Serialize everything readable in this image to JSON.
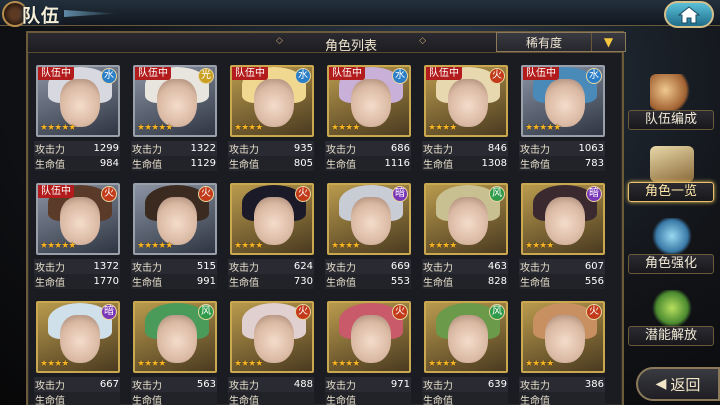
{
  "header": {
    "title": "队伍"
  },
  "panel": {
    "title": "角色列表",
    "sort_label": "稀有度"
  },
  "stat_labels": {
    "atk": "攻击力",
    "hp": "生命值"
  },
  "party_tag": "队伍中",
  "characters": [
    {
      "party": true,
      "element": "water",
      "stars": "★★★★★",
      "atk": "1299",
      "hp": "984"
    },
    {
      "party": true,
      "element": "light",
      "stars": "★★★★★",
      "atk": "1322",
      "hp": "1129"
    },
    {
      "party": true,
      "element": "water",
      "stars": "★★★★",
      "atk": "935",
      "hp": "805"
    },
    {
      "party": true,
      "element": "water",
      "stars": "★★★★",
      "atk": "686",
      "hp": "1116"
    },
    {
      "party": true,
      "element": "fire",
      "stars": "★★★★",
      "atk": "846",
      "hp": "1308"
    },
    {
      "party": true,
      "element": "water",
      "stars": "★★★★★",
      "atk": "1063",
      "hp": "783"
    },
    {
      "party": true,
      "element": "fire",
      "stars": "★★★★★",
      "atk": "1372",
      "hp": "1770"
    },
    {
      "party": false,
      "element": "fire",
      "stars": "★★★★★",
      "atk": "515",
      "hp": "991"
    },
    {
      "party": false,
      "element": "fire",
      "stars": "★★★★",
      "atk": "624",
      "hp": "730"
    },
    {
      "party": false,
      "element": "dark",
      "stars": "★★★★",
      "atk": "669",
      "hp": "553"
    },
    {
      "party": false,
      "element": "wind",
      "stars": "★★★★",
      "atk": "463",
      "hp": "828"
    },
    {
      "party": false,
      "element": "dark",
      "stars": "★★★★",
      "atk": "607",
      "hp": "556"
    },
    {
      "party": false,
      "element": "dark",
      "stars": "★★★★",
      "atk": "667",
      "hp": ""
    },
    {
      "party": false,
      "element": "wind",
      "stars": "★★★★",
      "atk": "563",
      "hp": ""
    },
    {
      "party": false,
      "element": "fire",
      "stars": "★★★★",
      "atk": "488",
      "hp": ""
    },
    {
      "party": false,
      "element": "fire",
      "stars": "★★★★",
      "atk": "971",
      "hp": ""
    },
    {
      "party": false,
      "element": "wind",
      "stars": "★★★★",
      "atk": "639",
      "hp": ""
    },
    {
      "party": false,
      "element": "fire",
      "stars": "★★★★",
      "atk": "386",
      "hp": ""
    }
  ],
  "side_menu": [
    {
      "label": "队伍编成",
      "active": false
    },
    {
      "label": "角色一览",
      "active": true
    },
    {
      "label": "角色强化",
      "active": false
    },
    {
      "label": "潜能解放",
      "active": false
    }
  ],
  "back_button": {
    "label": "返回"
  },
  "colors": {
    "party_tag": "#b31c1c",
    "accent_gold": "#c9a850",
    "star": "#f7b425"
  }
}
